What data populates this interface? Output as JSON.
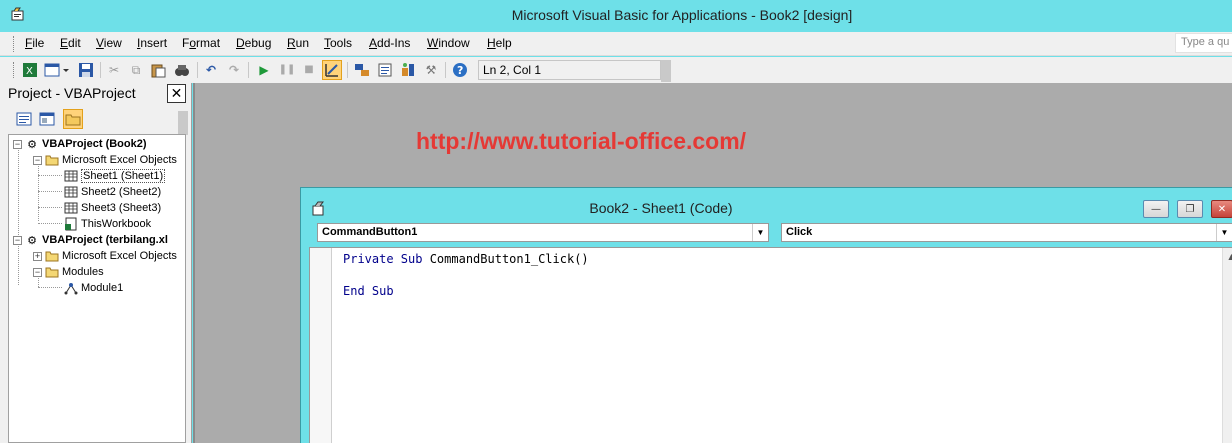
{
  "window": {
    "title": "Microsoft Visual Basic for Applications - Book2 [design]"
  },
  "menu": {
    "items": [
      {
        "name": "file",
        "u": "F",
        "rest": "ile"
      },
      {
        "name": "edit",
        "u": "E",
        "rest": "dit"
      },
      {
        "name": "view",
        "u": "V",
        "rest": "iew"
      },
      {
        "name": "insert",
        "u": "I",
        "rest": "nsert"
      },
      {
        "name": "format",
        "pre": "F",
        "u": "o",
        "rest": "rmat"
      },
      {
        "name": "debug",
        "u": "D",
        "rest": "ebug"
      },
      {
        "name": "run",
        "u": "R",
        "rest": "un"
      },
      {
        "name": "tools",
        "u": "T",
        "rest": "ools"
      },
      {
        "name": "add-ins",
        "u": "A",
        "rest": "dd-Ins"
      },
      {
        "name": "window",
        "u": "W",
        "rest": "indow"
      },
      {
        "name": "help",
        "u": "H",
        "rest": "elp"
      }
    ],
    "help_placeholder": "Type a qu"
  },
  "toolbar": {
    "status": "Ln 2, Col 1"
  },
  "project": {
    "title": "Project - VBAProject",
    "close": "✕",
    "tree": {
      "vbaproject_book2": "VBAProject (Book2)",
      "excel_objects_1": "Microsoft Excel Objects",
      "sheet1": "Sheet1 (Sheet1)",
      "sheet2": "Sheet2 (Sheet2)",
      "sheet3": "Sheet3 (Sheet3)",
      "thisworkbook": "ThisWorkbook",
      "vbaproject_terbilang": "VBAProject (terbilang.xl",
      "excel_objects_2": "Microsoft Excel Objects",
      "modules": "Modules",
      "module1": "Module1"
    }
  },
  "watermark": "http://www.tutorial-office.com/",
  "code_window": {
    "title": "Book2 - Sheet1 (Code)",
    "object_combo": "CommandButton1",
    "procedure_combo": "Click",
    "lines": {
      "l1_kw": "Private Sub",
      "l1_rest": " CommandButton1_Click()",
      "l2_kw": "End Sub"
    }
  },
  "colors": {
    "titlebar": "#6ee0e8",
    "watermark": "#e53935",
    "keyword": "#00008b"
  }
}
